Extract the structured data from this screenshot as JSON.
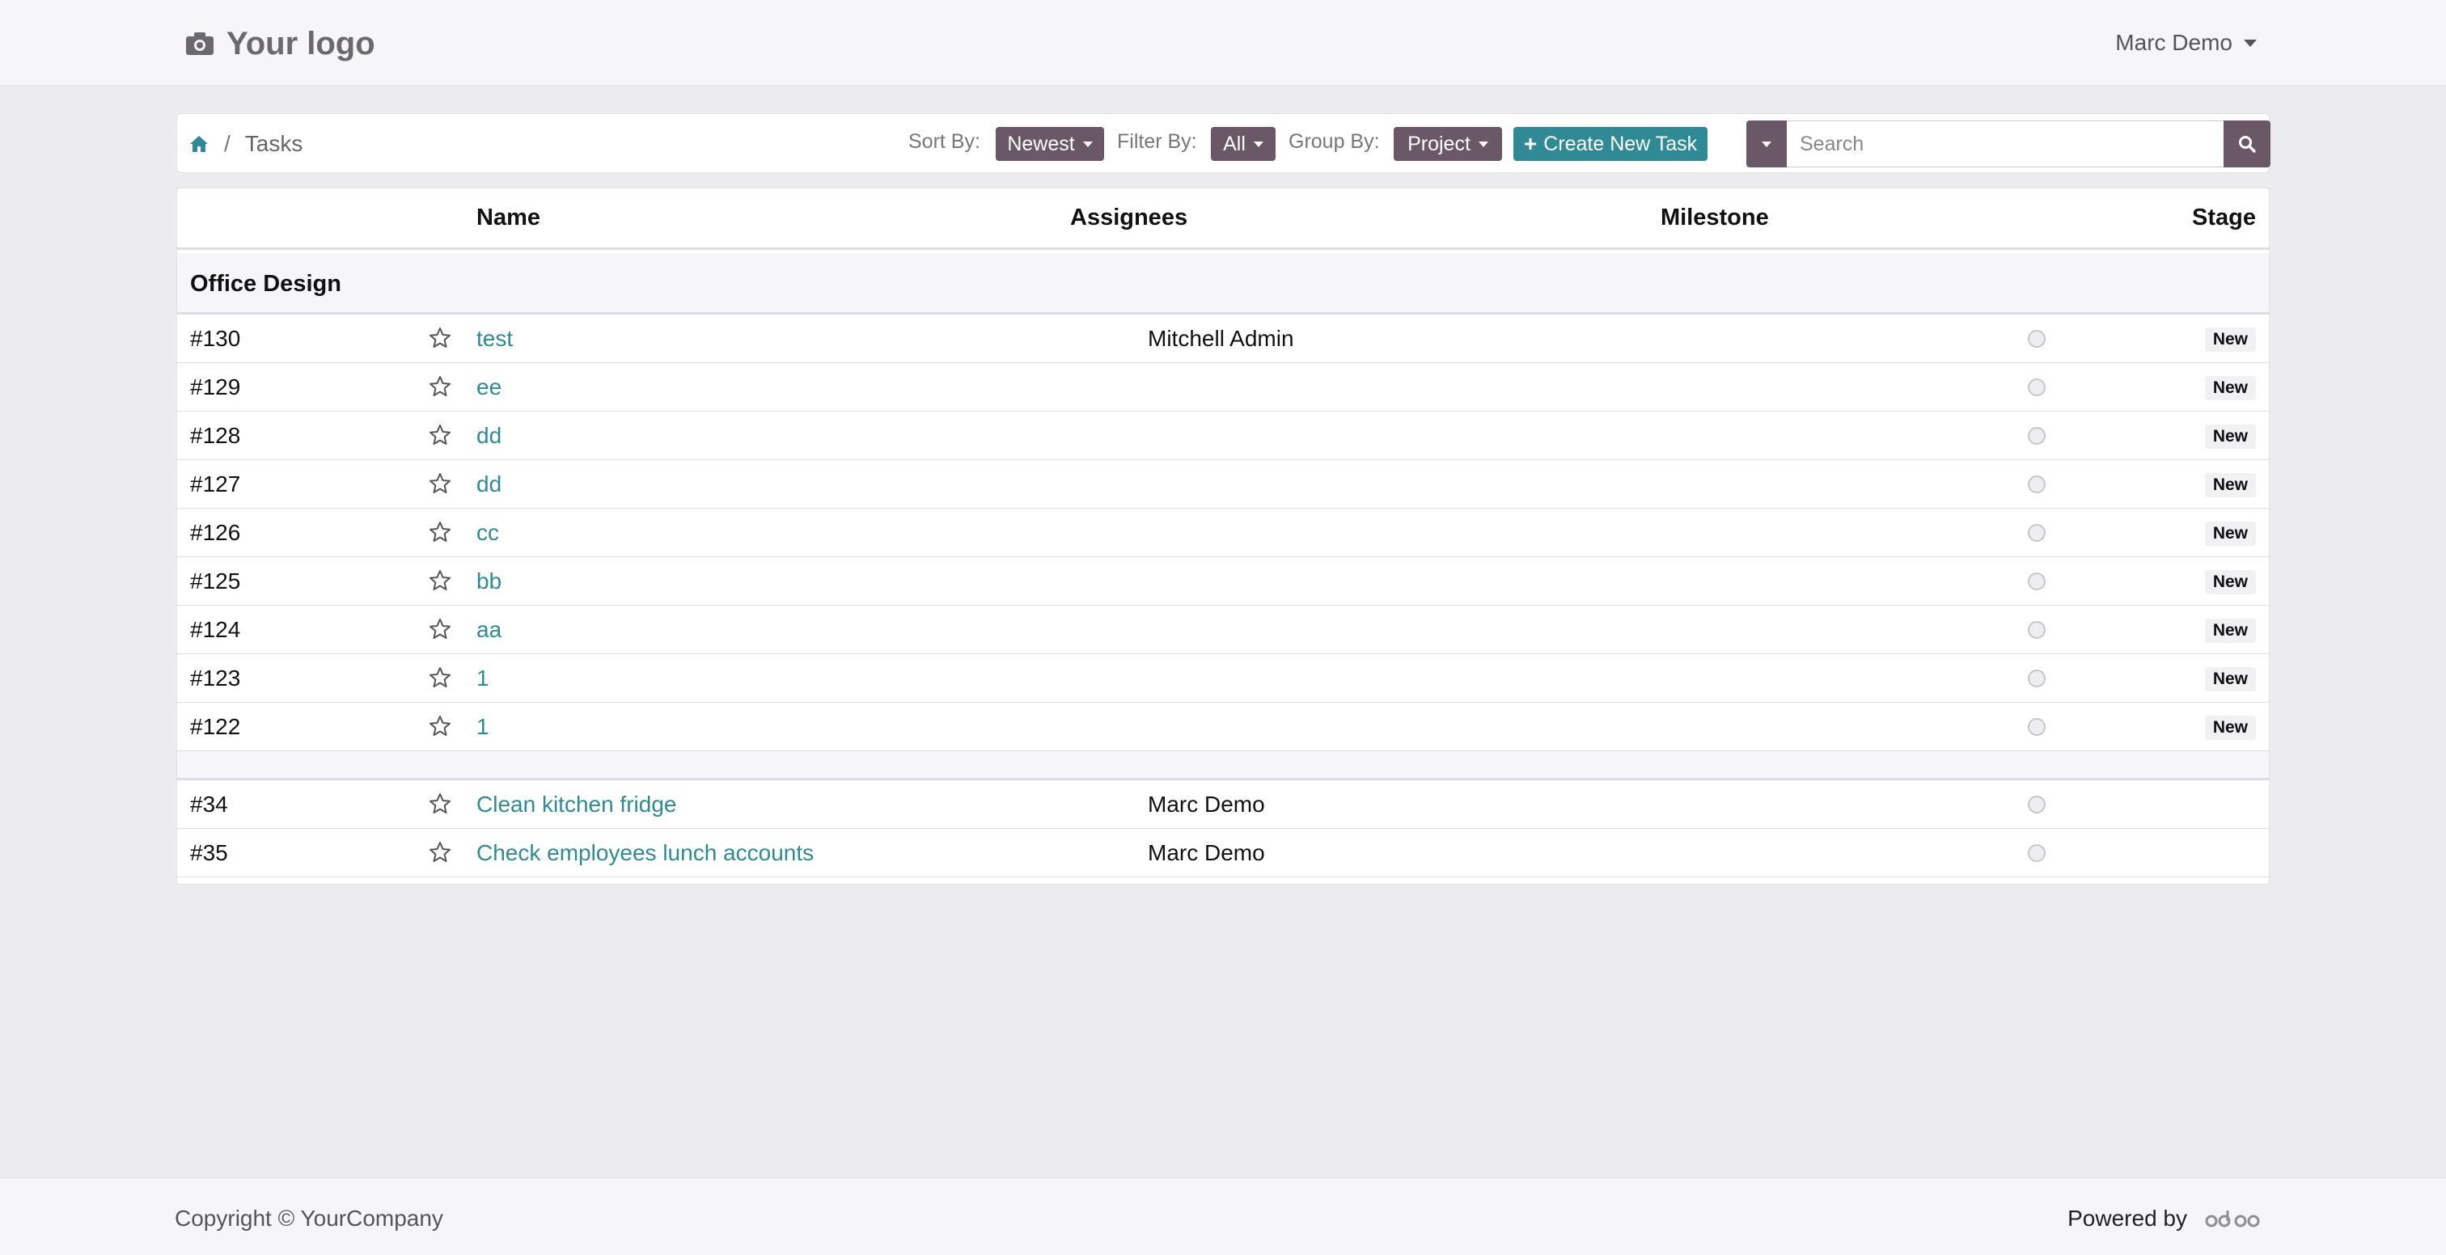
{
  "header": {
    "logo_text": "Your logo",
    "user_name": "Marc Demo"
  },
  "breadcrumb": {
    "current": "Tasks",
    "separator": "/"
  },
  "controls": {
    "sort_label": "Sort By:",
    "sort_value": "Newest",
    "filter_label": "Filter By:",
    "filter_value": "All",
    "group_label": "Group By:",
    "group_value": "Project",
    "create_label": "Create New Task",
    "search_placeholder": "Search"
  },
  "table": {
    "columns": {
      "name": "Name",
      "assignees": "Assignees",
      "milestone": "Milestone",
      "stage": "Stage"
    },
    "groups": [
      {
        "title": "Office Design",
        "rows": [
          {
            "id": "#130",
            "name": "test",
            "assignee": "Mitchell Admin",
            "stage": "New"
          },
          {
            "id": "#129",
            "name": "ee",
            "assignee": "",
            "stage": "New"
          },
          {
            "id": "#128",
            "name": "dd",
            "assignee": "",
            "stage": "New"
          },
          {
            "id": "#127",
            "name": "dd",
            "assignee": "",
            "stage": "New"
          },
          {
            "id": "#126",
            "name": "cc",
            "assignee": "",
            "stage": "New"
          },
          {
            "id": "#125",
            "name": "bb",
            "assignee": "",
            "stage": "New"
          },
          {
            "id": "#124",
            "name": "aa",
            "assignee": "",
            "stage": "New"
          },
          {
            "id": "#123",
            "name": "1",
            "assignee": "",
            "stage": "New"
          },
          {
            "id": "#122",
            "name": "1",
            "assignee": "",
            "stage": "New"
          }
        ]
      },
      {
        "title": "",
        "rows": [
          {
            "id": "#34",
            "name": "Clean kitchen fridge",
            "assignee": "Marc Demo",
            "stage": ""
          },
          {
            "id": "#35",
            "name": "Check employees lunch accounts",
            "assignee": "Marc Demo",
            "stage": ""
          }
        ]
      }
    ]
  },
  "footer": {
    "copyright": "Copyright © YourCompany",
    "powered_by": "Powered by",
    "brand": "odoo"
  },
  "colors": {
    "accent": "#2f8a96",
    "primary": "#6b5866",
    "background": "#ecebee"
  }
}
